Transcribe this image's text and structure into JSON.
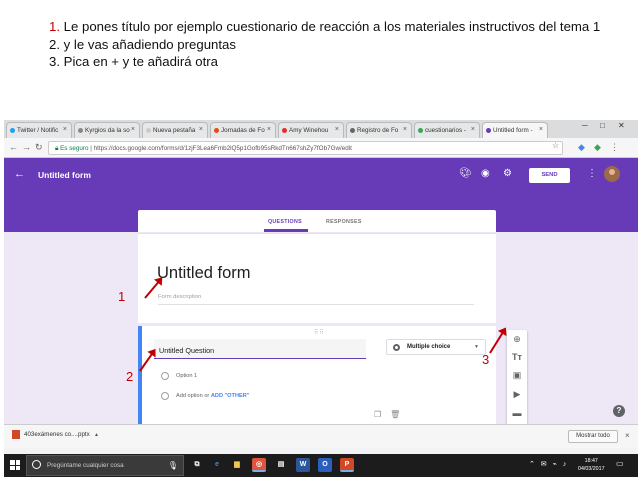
{
  "instructions": {
    "line1_num": "1.",
    "line1_text": " Le pones título por ejemplo cuestionario de reacción a los materiales instructivos del tema 1",
    "line2": "2. y le vas añadiendo preguntas",
    "line3": "3. Pica en + y te añadirá otra"
  },
  "browser": {
    "tabs": [
      {
        "label": "Twitter / Notific"
      },
      {
        "label": "Kyrgios da la so"
      },
      {
        "label": "Nueva pestaña"
      },
      {
        "label": "Jornadas de Fo"
      },
      {
        "label": "Amy Winehou"
      },
      {
        "label": "Registro de Fo"
      },
      {
        "label": "cuestionarios -"
      },
      {
        "label": "Untitled form -"
      }
    ],
    "secure_label": "Es seguro",
    "url": "https://docs.google.com/forms/d/1zjF3Lea6Fmb2lQ5p1Gofb95sRkdTn667shZy7fOb7Gw/edit"
  },
  "forms": {
    "doc_title": "Untitled form",
    "send_label": "SEND",
    "tab_questions": "QUESTIONS",
    "tab_responses": "RESPONSES",
    "form_title": "Untitled form",
    "form_description": "Form description",
    "question_title": "Untitled Question",
    "question_type": "Multiple choice",
    "option1": "Option 1",
    "add_option": "Add option",
    "or_label": "or",
    "add_other": "ADD \"OTHER\""
  },
  "downloads": {
    "file": "403exámenes co....pptx",
    "show_all": "Mostrar todo"
  },
  "taskbar": {
    "search_placeholder": "Pregúntame cualquier cosa",
    "time": "18:47",
    "date": "04/03/2017"
  },
  "annotations": {
    "n1": "1",
    "n2": "2",
    "n3": "3"
  },
  "colors": {
    "forms_purple": "#673ab7",
    "annotation_red": "#c00000",
    "accent_blue": "#4285f4"
  },
  "icons": [
    "back-arrow-icon",
    "palette-icon",
    "eye-icon",
    "gear-icon",
    "more-vert-icon",
    "add-circle-icon",
    "text-icon",
    "image-icon",
    "video-icon",
    "section-icon",
    "help-icon",
    "windows-logo-icon",
    "search-icon"
  ]
}
